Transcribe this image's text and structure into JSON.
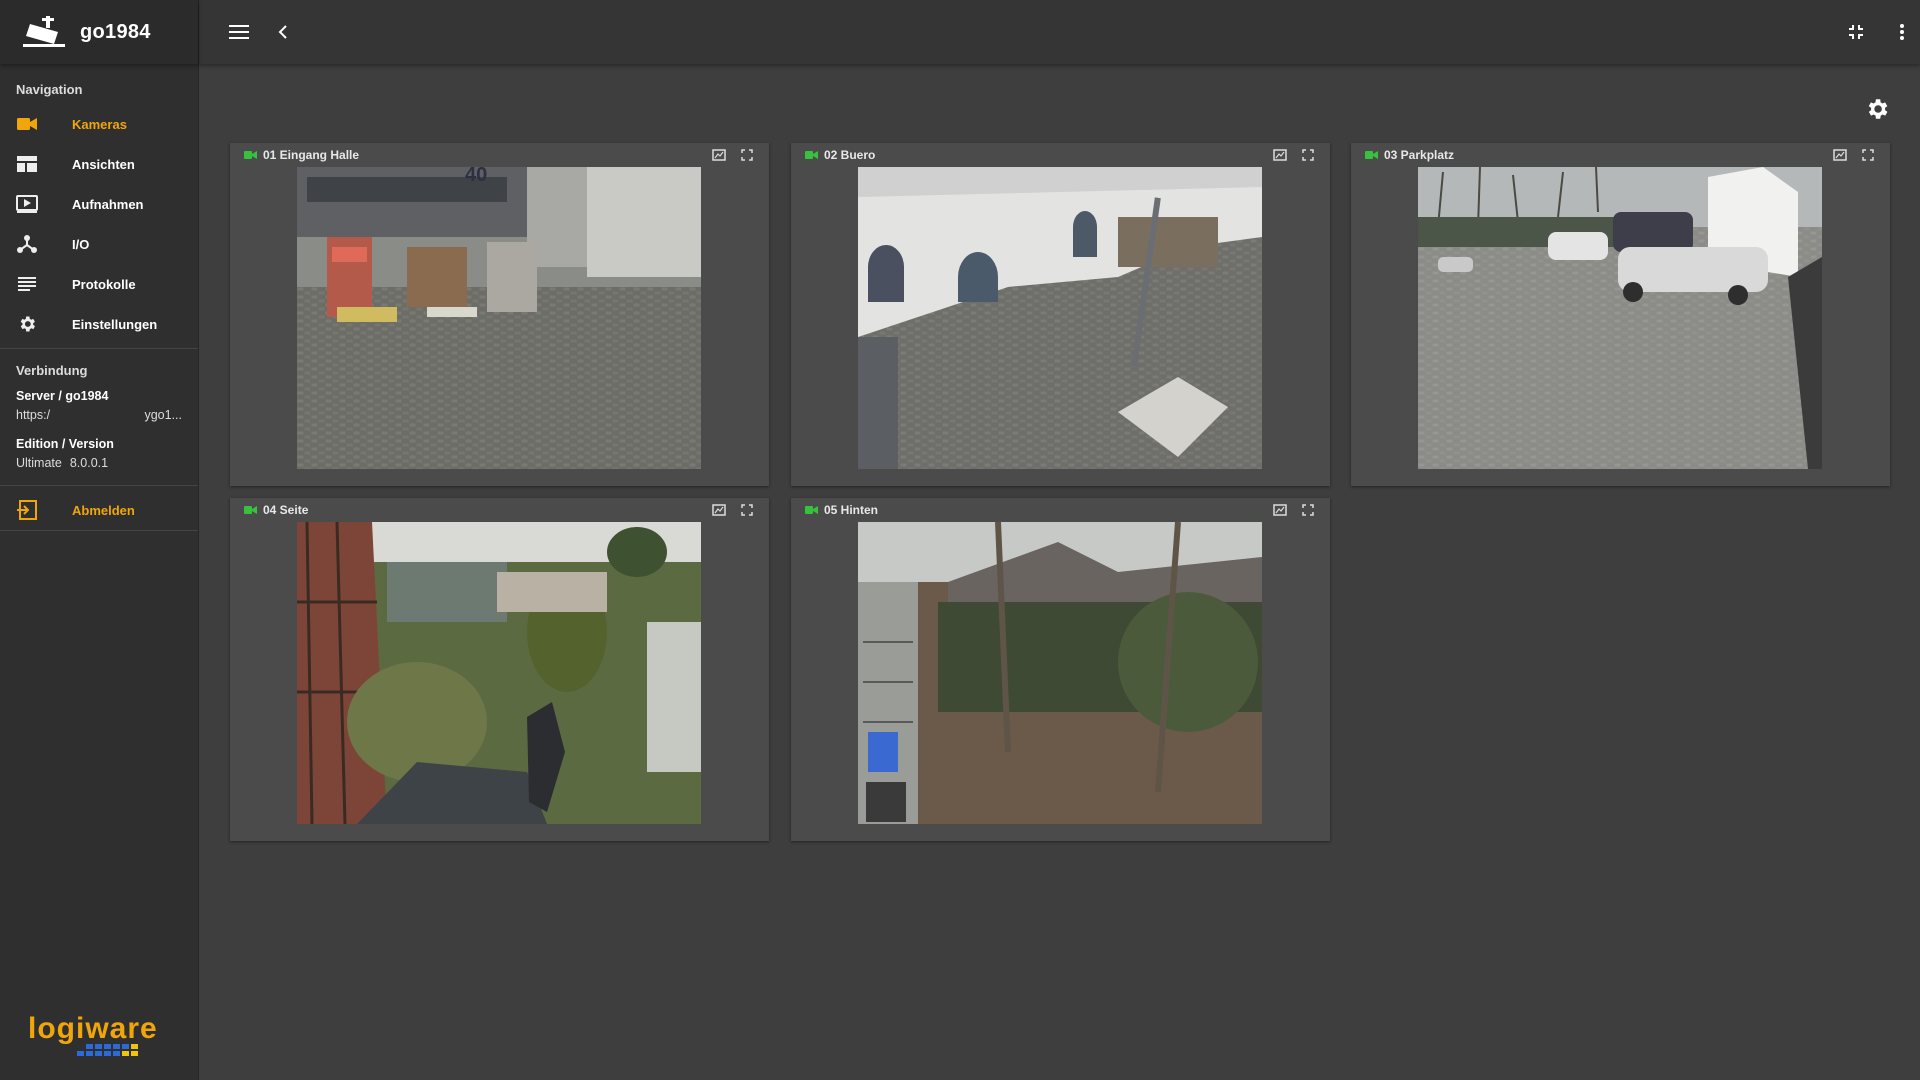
{
  "brand": {
    "name": "go1984",
    "icon": "security-camera-icon"
  },
  "topbar": {
    "menu_icon": "hamburger-icon",
    "back_icon": "chevron-left-icon",
    "exit_fullscreen_icon": "fullscreen-exit-icon",
    "more_icon": "more-vert-icon"
  },
  "sidebar": {
    "navigation_title": "Navigation",
    "items": [
      {
        "label": "Kameras",
        "icon": "videocam-icon",
        "active": true
      },
      {
        "label": "Ansichten",
        "icon": "view-layout-icon",
        "active": false
      },
      {
        "label": "Aufnahmen",
        "icon": "recording-icon",
        "active": false
      },
      {
        "label": "I/O",
        "icon": "io-hub-icon",
        "active": false
      },
      {
        "label": "Protokolle",
        "icon": "list-icon",
        "active": false
      },
      {
        "label": "Einstellungen",
        "icon": "gear-icon",
        "active": false
      }
    ],
    "connection_title": "Verbindung",
    "server_label": "Server / go1984",
    "server_url_start": "https:/",
    "server_url_end": "ygo1...",
    "edition_label": "Edition / Version",
    "edition_value": "Ultimate",
    "version_value": "8.0.0.1",
    "logout_label": "Abmelden",
    "footer_logo": "logiware"
  },
  "colors": {
    "accent": "#f0a60a",
    "live": "#36c23c",
    "bg": "#3e3e3e",
    "sidebar": "#2f2f2f",
    "tile": "#4b4b4b"
  },
  "cameras": [
    {
      "name": "01 Eingang Halle",
      "status": "live"
    },
    {
      "name": "02 Buero",
      "status": "live"
    },
    {
      "name": "03 Parkplatz",
      "status": "live"
    },
    {
      "name": "04 Seite",
      "status": "live"
    },
    {
      "name": "05 Hinten",
      "status": "live"
    }
  ]
}
